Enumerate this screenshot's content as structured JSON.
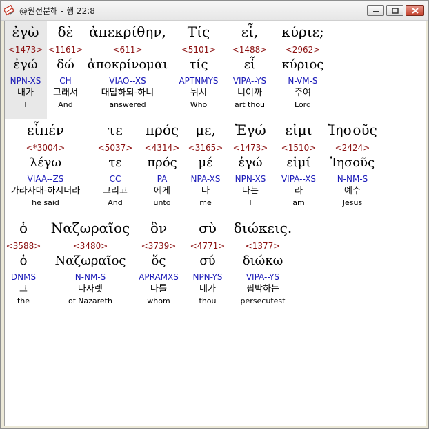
{
  "window": {
    "title": "@원전분해 - 행 22:8",
    "minimize_icon": "minimize-icon",
    "maximize_icon": "maximize-icon",
    "close_icon": "close-icon"
  },
  "colors": {
    "strong": "#8b1010",
    "parsing": "#1a1ab8",
    "selection": "#e8e8e8"
  },
  "rows": [
    {
      "words": [
        {
          "greek": "ἐγὼ",
          "strong": "<1473>",
          "lemma": "ἐγώ",
          "parse": "NPN-XS",
          "korean": "내가",
          "english": "I"
        },
        {
          "greek": "δὲ",
          "strong": "<1161>",
          "lemma": "δώ",
          "parse": "CH",
          "korean": "그래서",
          "english": "And"
        },
        {
          "greek": "ἀπεκρίθην,",
          "strong": "<611>",
          "lemma": "ἀποκρίνομαι",
          "parse": "VIAO--XS",
          "korean": "대답하되-하니",
          "english": "answered"
        },
        {
          "greek": "Τίς",
          "strong": "<5101>",
          "lemma": "τίς",
          "parse": "APTNMYS",
          "korean": "뉘시",
          "english": "Who"
        },
        {
          "greek": "εἶ,",
          "strong": "<1488>",
          "lemma": "εἶ",
          "parse": "VIPA--YS",
          "korean": "니이까",
          "english": "art thou"
        },
        {
          "greek": "κύριε;",
          "strong": "<2962>",
          "lemma": "κύριος",
          "parse": "N-VM-S",
          "korean": "주여",
          "english": "Lord"
        }
      ]
    },
    {
      "words": [
        {
          "greek": "εἶπέν",
          "strong": "<*3004>",
          "lemma": "λέγω",
          "parse": "VIAA--ZS",
          "korean": "가라사대-하시더라",
          "english": "he said"
        },
        {
          "greek": "τε",
          "strong": "<5037>",
          "lemma": "τε",
          "parse": "CC",
          "korean": "그리고",
          "english": "And"
        },
        {
          "greek": "πρός",
          "strong": "<4314>",
          "lemma": "πρός",
          "parse": "PA",
          "korean": "에게",
          "english": "unto"
        },
        {
          "greek": "με,",
          "strong": "<3165>",
          "lemma": "μέ",
          "parse": "NPA-XS",
          "korean": "나",
          "english": "me"
        },
        {
          "greek": "Ἐγώ",
          "strong": "<1473>",
          "lemma": "ἐγώ",
          "parse": "NPN-XS",
          "korean": "나는",
          "english": "I"
        },
        {
          "greek": "εἰμι",
          "strong": "<1510>",
          "lemma": "εἰμί",
          "parse": "VIPA--XS",
          "korean": "라",
          "english": "am"
        },
        {
          "greek": "Ἰησοῦς",
          "strong": "<2424>",
          "lemma": "Ἰησοῦς",
          "parse": "N-NM-S",
          "korean": "예수",
          "english": "Jesus"
        }
      ]
    },
    {
      "words": [
        {
          "greek": "ὁ",
          "strong": "<3588>",
          "lemma": "ὁ",
          "parse": "DNMS",
          "korean": "그",
          "english": "the"
        },
        {
          "greek": "Ναζωραῖος",
          "strong": "<3480>",
          "lemma": "Ναζωραῖος",
          "parse": "N-NM-S",
          "korean": "나사렛",
          "english": "of Nazareth"
        },
        {
          "greek": "ὃν",
          "strong": "<3739>",
          "lemma": "ὅς",
          "parse": "APRAMXS",
          "korean": "나를",
          "english": "whom"
        },
        {
          "greek": "σὺ",
          "strong": "<4771>",
          "lemma": "σύ",
          "parse": "NPN-YS",
          "korean": "네가",
          "english": "thou"
        },
        {
          "greek": "διώκεις.",
          "strong": "<1377>",
          "lemma": "διώκω",
          "parse": "VIPA--YS",
          "korean": "핍박하는",
          "english": "persecutest"
        }
      ]
    }
  ]
}
